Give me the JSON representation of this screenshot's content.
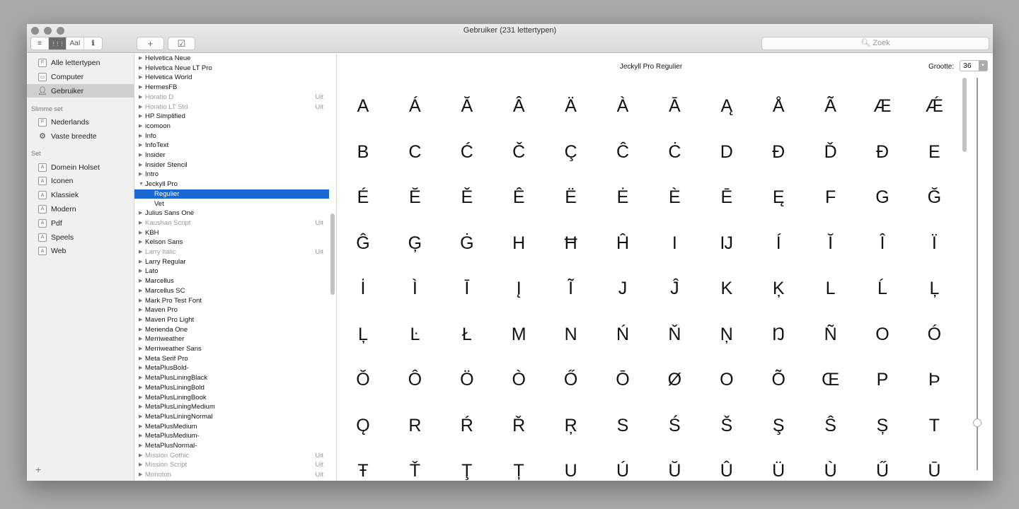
{
  "window": {
    "title": "Gebruiker (231 lettertypen)"
  },
  "toolbar": {
    "view_buttons": [
      {
        "icon": "list-icon",
        "glyph": "≡"
      },
      {
        "icon": "grid-icon",
        "glyph": "⋮⋮⋮",
        "selected": true
      },
      {
        "icon": "sample-icon",
        "glyph": "AaI"
      },
      {
        "icon": "info-icon",
        "glyph": "ℹ"
      }
    ],
    "add_glyph": "+",
    "validate_glyph": "☑",
    "search_placeholder": "Zoek"
  },
  "sidebar": {
    "library_items": [
      {
        "label": "Alle lettertypen",
        "icon": "font-file-icon"
      },
      {
        "label": "Computer",
        "icon": "computer-icon"
      },
      {
        "label": "Gebruiker",
        "icon": "user-icon",
        "selected": true
      }
    ],
    "smart_header": "Slimme set",
    "smart_items": [
      {
        "label": "Nederlands",
        "icon": "font-file-icon"
      },
      {
        "label": "Vaste breedte",
        "icon": "gear-icon"
      }
    ],
    "set_header": "Set",
    "set_items": [
      {
        "label": "Domein Holset"
      },
      {
        "label": "Iconen"
      },
      {
        "label": "Klassiek"
      },
      {
        "label": "Modern"
      },
      {
        "label": "Pdf"
      },
      {
        "label": "Speels"
      },
      {
        "label": "Web"
      }
    ],
    "add_glyph": "+"
  },
  "font_list": [
    {
      "name": "Helvetica Neue"
    },
    {
      "name": "Helvetica Neue LT Pro"
    },
    {
      "name": "Helvetica World"
    },
    {
      "name": "HermesFB"
    },
    {
      "name": "Horatio D",
      "status": "Uit"
    },
    {
      "name": "Horatio LT Std",
      "status": "Uit"
    },
    {
      "name": "HP Simplified"
    },
    {
      "name": "icomoon"
    },
    {
      "name": "Info"
    },
    {
      "name": "InfoText"
    },
    {
      "name": "Insider"
    },
    {
      "name": "Insider Stencil"
    },
    {
      "name": "Intro"
    },
    {
      "name": "Jeckyll Pro",
      "expanded": true
    },
    {
      "name": "Regulier",
      "sub": true,
      "selected": true
    },
    {
      "name": "Vet",
      "sub": true
    },
    {
      "name": "Julius Sans One"
    },
    {
      "name": "Kaushan Script",
      "status": "Uit"
    },
    {
      "name": "KBH"
    },
    {
      "name": "Kelson Sans"
    },
    {
      "name": "Larry Italic",
      "status": "Uit"
    },
    {
      "name": "Larry Regular"
    },
    {
      "name": "Lato"
    },
    {
      "name": "Marcellus"
    },
    {
      "name": "Marcellus SC"
    },
    {
      "name": "Mark Pro Test Font"
    },
    {
      "name": "Maven Pro"
    },
    {
      "name": "Maven Pro Light"
    },
    {
      "name": "Merienda One"
    },
    {
      "name": "Merriweather"
    },
    {
      "name": "Merriweather Sans"
    },
    {
      "name": "Meta Serif Pro"
    },
    {
      "name": "MetaPlusBold-"
    },
    {
      "name": "MetaPlusLiningBlack"
    },
    {
      "name": "MetaPlusLiningBold"
    },
    {
      "name": "MetaPlusLiningBook"
    },
    {
      "name": "MetaPlusLiningMedium"
    },
    {
      "name": "MetaPlusLiningNormal"
    },
    {
      "name": "MetaPlusMedium"
    },
    {
      "name": "MetaPlusMedium-"
    },
    {
      "name": "MetaPlusNormal-"
    },
    {
      "name": "Mission Gothic",
      "status": "Uit"
    },
    {
      "name": "Mission Script",
      "status": "Uit"
    },
    {
      "name": "Monoton",
      "status": "Uit"
    }
  ],
  "preview": {
    "font_title": "Jeckyll Pro Regulier",
    "size_label": "Grootte:",
    "size_value": "36",
    "size_slider_fraction": 0.12,
    "glyph_rows": [
      [
        "A",
        "Á",
        "Ă",
        "Â",
        "Ä",
        "À",
        "Ā",
        "Ą",
        "Å",
        "Ã",
        "Æ",
        "Ǽ"
      ],
      [
        "B",
        "C",
        "Ć",
        "Č",
        "Ç",
        "Ĉ",
        "Ċ",
        "D",
        "Đ",
        "Ď",
        "Ð",
        "E"
      ],
      [
        "É",
        "Ĕ",
        "Ě",
        "Ê",
        "Ë",
        "Ė",
        "È",
        "Ē",
        "Ę",
        "F",
        "G",
        "Ğ"
      ],
      [
        "Ĝ",
        "Ģ",
        "Ġ",
        "H",
        "Ħ",
        "Ĥ",
        "I",
        "Ĳ",
        "Í",
        "Ĭ",
        "Î",
        "Ï"
      ],
      [
        "İ",
        "Ì",
        "Ī",
        "Į",
        "Ĩ",
        "J",
        "Ĵ",
        "K",
        "Ķ",
        "L",
        "Ĺ",
        "Ļ"
      ],
      [
        "Ļ",
        "Ŀ",
        "Ł",
        "M",
        "N",
        "Ń",
        "Ň",
        "Ņ",
        "Ŋ",
        "Ñ",
        "O",
        "Ó"
      ],
      [
        "Ŏ",
        "Ô",
        "Ö",
        "Ò",
        "Ő",
        "Ō",
        "Ø",
        "O",
        "Õ",
        "Œ",
        "P",
        "Þ"
      ],
      [
        "Ǫ",
        "R",
        "Ŕ",
        "Ř",
        "Ŗ",
        "S",
        "Ś",
        "Š",
        "Ş",
        "Ŝ",
        "Ș",
        "T"
      ],
      [
        "Ŧ",
        "Ť",
        "Ţ",
        "Ț",
        "U",
        "Ú",
        "Ŭ",
        "Û",
        "Ü",
        "Ù",
        "Ű",
        "Ū"
      ]
    ]
  },
  "colors": {
    "selection": "#1a68d6",
    "sidebar_bg": "#f0f0f0"
  }
}
